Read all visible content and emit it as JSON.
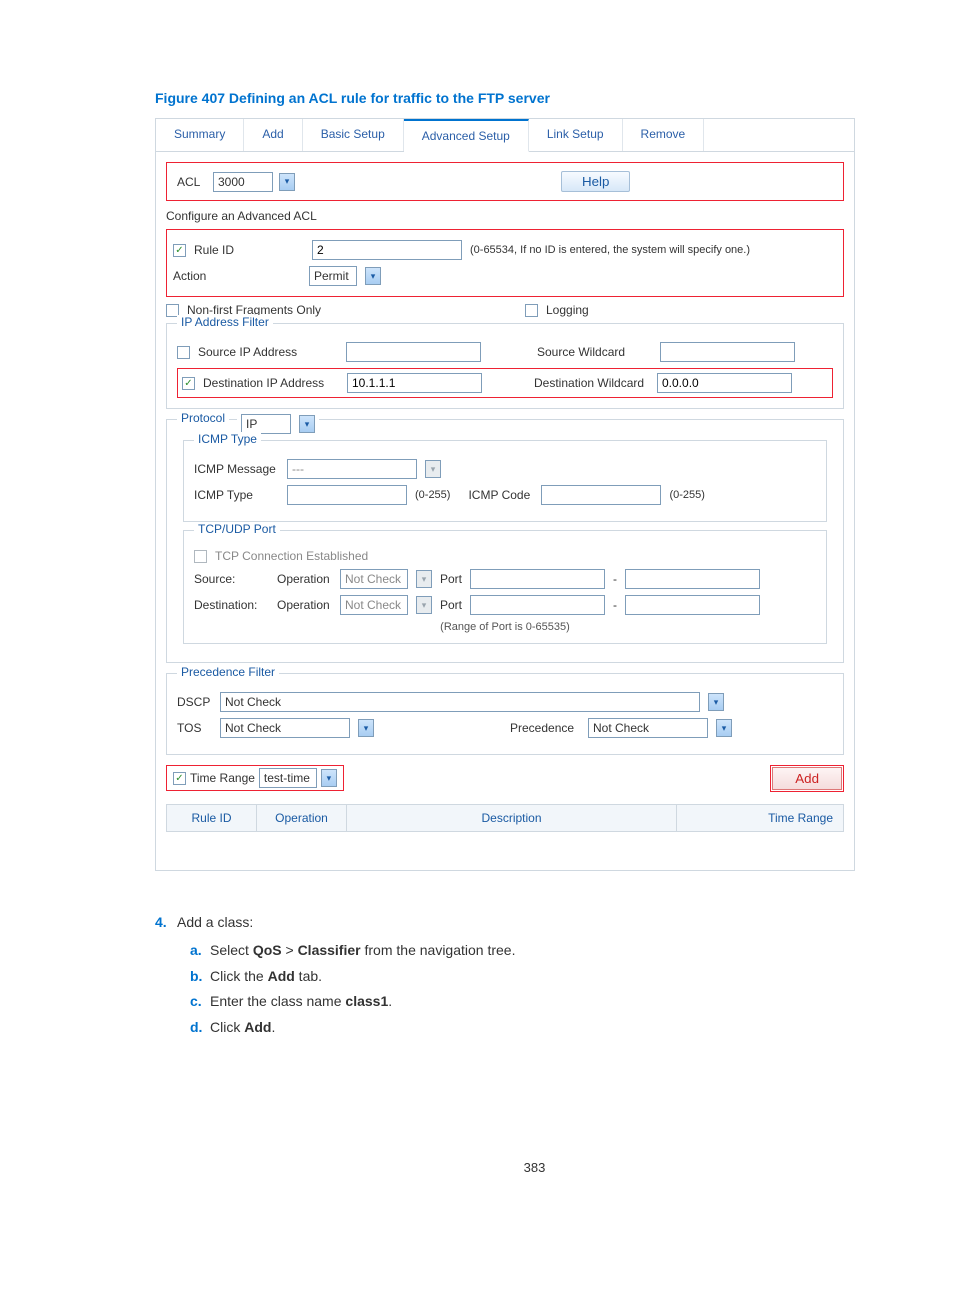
{
  "figure_title": "Figure 407 Defining an ACL rule for traffic to the FTP server",
  "tabs": {
    "summary": "Summary",
    "add": "Add",
    "basic": "Basic Setup",
    "advanced": "Advanced Setup",
    "link": "Link Setup",
    "remove": "Remove"
  },
  "acl": {
    "label": "ACL",
    "value": "3000",
    "help": "Help"
  },
  "config_heading": "Configure an Advanced ACL",
  "rule_id": {
    "label": "Rule ID",
    "value": "2",
    "hint": "(0-65534, If no ID is entered, the system will specify one.)"
  },
  "action": {
    "label": "Action",
    "value": "Permit"
  },
  "nonfirst": "Non-first Fragments Only",
  "logging": "Logging",
  "ip_filter": {
    "legend": "IP Address Filter",
    "src_cb": "Source IP Address",
    "src_wc_lbl": "Source Wildcard",
    "dst_cb": "Destination IP Address",
    "dst_val": "10.1.1.1",
    "dst_wc_lbl": "Destination Wildcard",
    "dst_wc_val": "0.0.0.0"
  },
  "protocol": {
    "legend": "Protocol",
    "value": "IP"
  },
  "icmp": {
    "legend": "ICMP Type",
    "msg_lbl": "ICMP Message",
    "msg_val": "---",
    "type_lbl": "ICMP Type",
    "range": "(0-255)",
    "code_lbl": "ICMP Code"
  },
  "tcpudp": {
    "legend": "TCP/UDP Port",
    "est": "TCP Connection Established",
    "src": "Source:",
    "dst": "Destination:",
    "op": "Operation",
    "opval": "Not Check",
    "port": "Port",
    "dash": "-",
    "range": "(Range of Port is 0-65535)"
  },
  "prec": {
    "legend": "Precedence Filter",
    "dscp_lbl": "DSCP",
    "dscp_val": "Not Check",
    "tos_lbl": "TOS",
    "tos_val": "Not Check",
    "prec_lbl": "Precedence",
    "prec_val": "Not Check"
  },
  "timerange": {
    "label": "Time Range",
    "value": "test-time"
  },
  "add_btn": "Add",
  "cols": {
    "rid": "Rule ID",
    "op": "Operation",
    "desc": "Description",
    "tr": "Time Range"
  },
  "body": {
    "n4": "4.",
    "n4_txt": "Add a class:",
    "a": "a.",
    "a_txt1": "Select ",
    "a_b1": "QoS",
    "a_mid": " > ",
    "a_b2": "Classifier",
    "a_txt2": " from the navigation tree.",
    "b": "b.",
    "b_txt1": "Click the ",
    "b_b": "Add",
    "b_txt2": " tab.",
    "c": "c.",
    "c_txt1": "Enter the class name ",
    "c_b": "class1",
    "c_txt2": ".",
    "d": "d.",
    "d_txt1": "Click ",
    "d_b": "Add",
    "d_txt2": "."
  },
  "page": "383"
}
